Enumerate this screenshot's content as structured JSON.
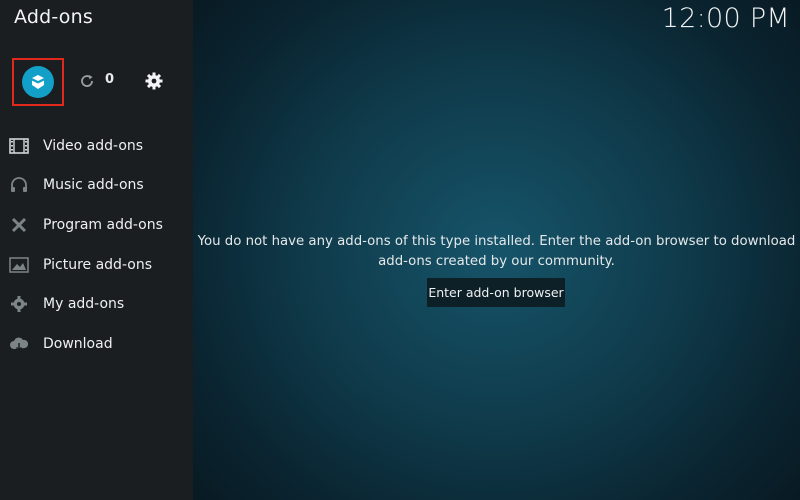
{
  "header": {
    "title": "Add-ons",
    "clock": "12:00 PM"
  },
  "toolbar": {
    "addon_browser_icon": "open-box-icon",
    "refresh_icon": "refresh-icon",
    "refresh_count": "0",
    "settings_icon": "gear-icon",
    "highlight_color": "#e0281c",
    "accent_color": "#12a0c8"
  },
  "sidebar": {
    "items": [
      {
        "label": "Video add-ons",
        "icon": "film-strip-icon"
      },
      {
        "label": "Music add-ons",
        "icon": "headphones-icon"
      },
      {
        "label": "Program add-ons",
        "icon": "tools-icon"
      },
      {
        "label": "Picture add-ons",
        "icon": "picture-icon"
      },
      {
        "label": "My add-ons",
        "icon": "gear-cog-icon"
      },
      {
        "label": "Download",
        "icon": "cloud-download-icon"
      }
    ]
  },
  "main": {
    "message_line1": "You do not have any add-ons of this type installed. Enter the add-on browser to download",
    "message_line2": "add-ons created by our community.",
    "browser_button": "Enter add-on browser"
  }
}
